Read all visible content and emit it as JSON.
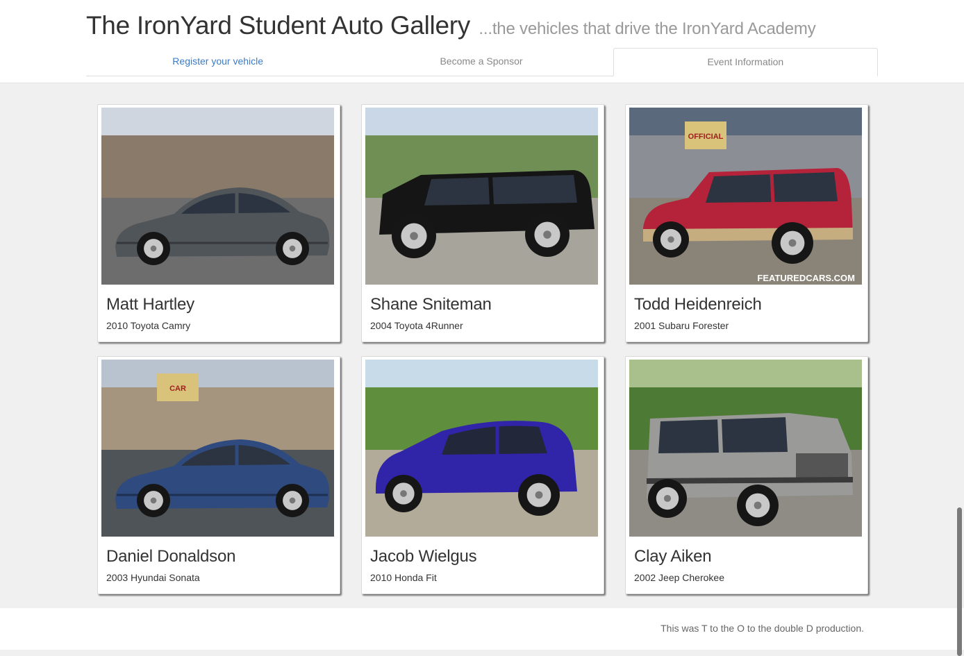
{
  "header": {
    "title": "The IronYard Student Auto Gallery",
    "subtitle": "...the vehicles that drive the IronYard Academy"
  },
  "nav": {
    "tabs": [
      {
        "label": "Register your vehicle"
      },
      {
        "label": "Become a Sponsor"
      },
      {
        "label": "Event Information"
      }
    ]
  },
  "cars": [
    {
      "owner": "Matt Hartley",
      "vehicle": "2010 Toyota Camry",
      "color": "#50555a",
      "type": "sedan"
    },
    {
      "owner": "Shane Sniteman",
      "vehicle": "2004 Toyota 4Runner",
      "color": "#151515",
      "type": "suv"
    },
    {
      "owner": "Todd Heidenreich",
      "vehicle": "2001 Subaru Forester",
      "color": "#b5233a",
      "type": "wagon",
      "watermark": "FEATUREDCARS.COM",
      "sign": "OFFICIAL"
    },
    {
      "owner": "Daniel Donaldson",
      "vehicle": "2003 Hyundai Sonata",
      "color": "#2e4a7e",
      "type": "sedan",
      "sign": "CAR"
    },
    {
      "owner": "Jacob Wielgus",
      "vehicle": "2010 Honda Fit",
      "color": "#3024a8",
      "type": "hatch"
    },
    {
      "owner": "Clay Aiken",
      "vehicle": "2002 Jeep Cherokee",
      "color": "#9a9a98",
      "type": "jeep"
    }
  ],
  "footer": {
    "text": "This was T to the O to the double D production."
  }
}
